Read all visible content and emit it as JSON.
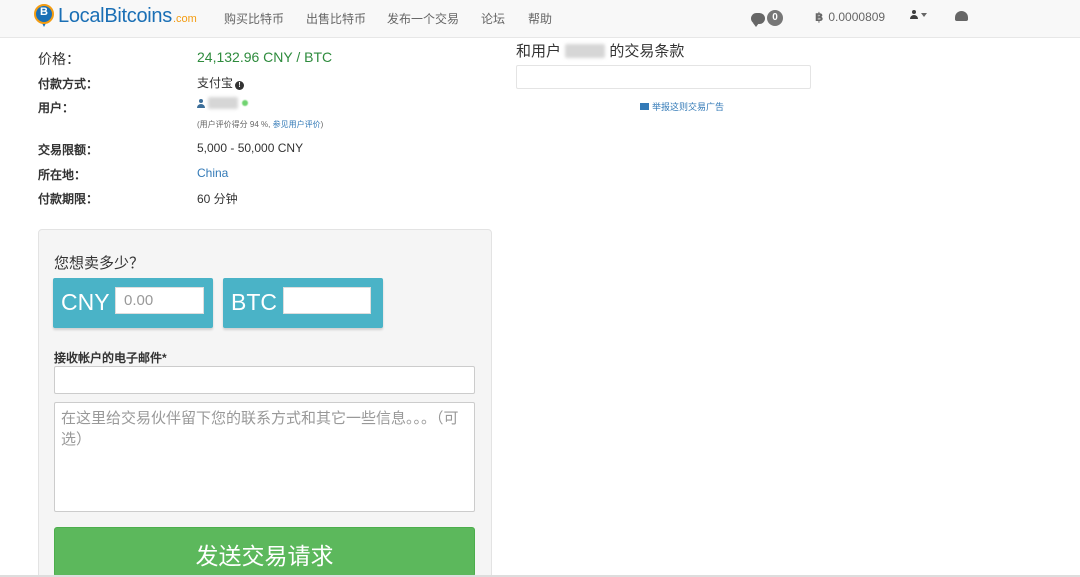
{
  "nav": {
    "brand": "LocalBitcoins",
    "brand_suffix": ".com",
    "links": [
      "购买比特币",
      "出售比特币",
      "发布一个交易",
      "论坛",
      "帮助"
    ],
    "messages_count": "0",
    "balance": "0.0000809"
  },
  "details": {
    "price_label": "价格：",
    "price_value": "24,132.96 CNY / BTC",
    "payment_label": "付款方式：",
    "payment_value": "支付宝",
    "user_label": "用户：",
    "user_rating_prefix": "(用户评价得分 94 %, ",
    "user_rating_link": "参见用户评价",
    "user_rating_suffix": ")",
    "limits_label": "交易限额：",
    "limits_value": "5,000 - 50,000 CNY",
    "location_label": "所在地：",
    "location_value": "China",
    "window_label": "付款期限：",
    "window_value": "60 分钟"
  },
  "terms": {
    "title_prefix": "和用户",
    "title_suffix": "的交易条款",
    "report_link": "举报这则交易广告"
  },
  "form": {
    "question": "您想卖多少？",
    "fiat_currency": "CNY",
    "fiat_placeholder": "0.00",
    "crypto_currency": "BTC",
    "crypto_value": "",
    "email_label": "接收帐户的电子邮件*",
    "email_value": "",
    "message_placeholder": "在这里给交易伙伴留下您的联系方式和其它一些信息。。。（可选）",
    "submit_label": "发送交易请求"
  },
  "colors": {
    "brand_blue": "#1a6fb5",
    "price_green": "#2e8b3d",
    "amount_teal": "#4ab3c7",
    "submit_green": "#5cb85c",
    "link_blue": "#337ab7"
  }
}
